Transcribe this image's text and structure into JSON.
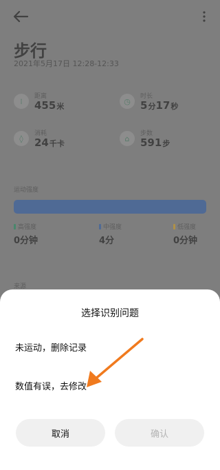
{
  "page": {
    "title": "步行",
    "datetime": "2021年5月17日 12:28-12:33"
  },
  "metrics": [
    {
      "label": "距离",
      "value": "455",
      "unit": "米",
      "icon": "distance-icon"
    },
    {
      "label": "时长",
      "value": "5",
      "unit": "分",
      "value2": "17",
      "unit2": "秒",
      "icon": "clock-icon"
    },
    {
      "label": "消耗",
      "value": "24",
      "unit": "千卡",
      "icon": "flame-icon"
    },
    {
      "label": "步数",
      "value": "591",
      "unit": "步",
      "icon": "shoe-icon"
    }
  ],
  "intensity": {
    "label": "运动强度",
    "items": [
      {
        "label": "高强度",
        "value": "0",
        "unit": "分钟",
        "color": "#1f8f5f"
      },
      {
        "label": "中强度",
        "value": "4",
        "unit": "分",
        "color": "#2a5aa8"
      },
      {
        "label": "低强度",
        "value": "0",
        "unit": "分钟",
        "color": "#d9a21b"
      }
    ],
    "bar_color": "#2a5aa8"
  },
  "source_label": "来源",
  "sheet": {
    "title": "选择识别问题",
    "options": [
      "未运动，删除记录",
      "数值有误，去修改"
    ],
    "cancel": "取消",
    "confirm": "确认"
  },
  "colors": {
    "annotation_arrow": "#f07a1e"
  }
}
